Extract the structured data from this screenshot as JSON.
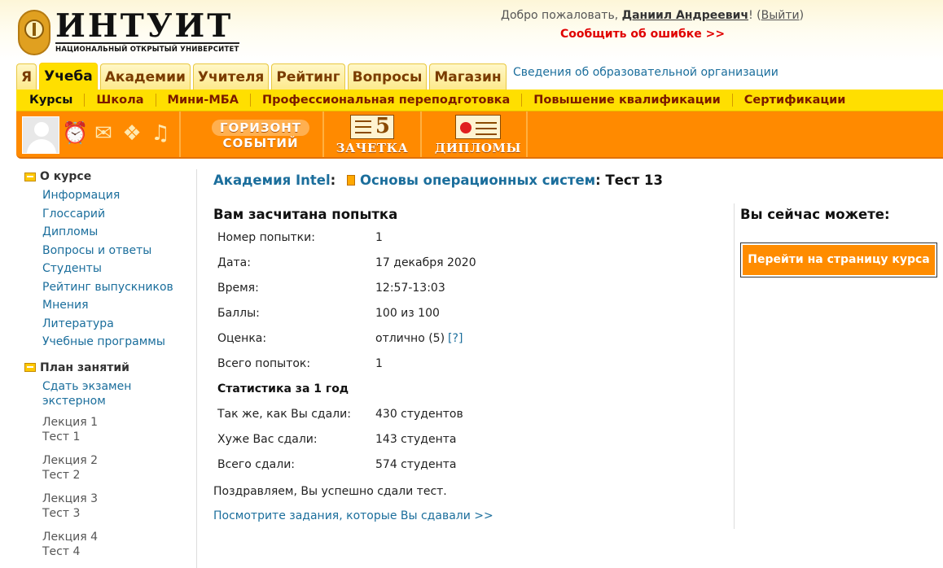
{
  "header": {
    "logo_title": "ИНТУИТ",
    "logo_subtitle": "НАЦИОНАЛЬНЫЙ ОТКРЫТЫЙ УНИВЕРСИТЕТ",
    "welcome_prefix": "Добро пожаловать,",
    "user_name": "Даниил Андреевич",
    "welcome_excl": "!",
    "logout_open": "(",
    "logout_label": "Выйти",
    "logout_close": ")",
    "report_error": "Сообщить об ошибке >>"
  },
  "tabs": [
    {
      "label": "Я",
      "active": false
    },
    {
      "label": "Учеба",
      "active": true
    },
    {
      "label": "Академии",
      "active": false
    },
    {
      "label": "Учителя",
      "active": false
    },
    {
      "label": "Рейтинг",
      "active": false
    },
    {
      "label": "Вопросы",
      "active": false
    },
    {
      "label": "Магазин",
      "active": false
    }
  ],
  "org_info_link": "Сведения об образовательной организации",
  "subnav": [
    {
      "label": "Курсы",
      "active": true
    },
    {
      "label": "Школа",
      "active": false
    },
    {
      "label": "Мини-МБА",
      "active": false
    },
    {
      "label": "Профессиональная переподготовка",
      "active": false
    },
    {
      "label": "Повышение квалификации",
      "active": false
    },
    {
      "label": "Сертификации",
      "active": false
    }
  ],
  "toolbar": {
    "horizon_line1": "ГОРИЗОНТ",
    "horizon_line2": "СОБЫТИЙ",
    "zachetka_label": "ЗАЧЕТКА",
    "zachetka_number": "5",
    "diplomy_label": "ДИПЛОМЫ",
    "icons": [
      "alarm-clock-icon",
      "envelope-icon",
      "gifts-icon",
      "bell-icon"
    ]
  },
  "sidebar": {
    "about_title": "О курсе",
    "about_links": [
      "Информация",
      "Глоссарий",
      "Дипломы",
      "Вопросы и ответы",
      "Студенты",
      "Рейтинг выпускников",
      "Мнения",
      "Литература",
      "Учебные программы"
    ],
    "plan_title": "План занятий",
    "external_exam": "Сдать экзамен экстерном",
    "lectures": [
      {
        "lecture": "Лекция 1",
        "test": "Тест 1"
      },
      {
        "lecture": "Лекция 2",
        "test": "Тест 2"
      },
      {
        "lecture": "Лекция 3",
        "test": "Тест 3"
      },
      {
        "lecture": "Лекция 4",
        "test": "Тест 4"
      }
    ]
  },
  "breadcrumb": {
    "academy": "Академия Intel",
    "sep1": ":",
    "course": "Основы операционных систем",
    "sep2": ":",
    "current": "Тест 13"
  },
  "result": {
    "title": "Вам засчитана попытка",
    "attempt_label": "Номер попытки:",
    "attempt_value": "1",
    "date_label": "Дата:",
    "date_value": "17 декабря 2020",
    "time_label": "Время:",
    "time_value": "12:57-13:03",
    "score_label": "Баллы:",
    "score_value": "100 из 100",
    "grade_label": "Оценка:",
    "grade_value": "отлично (5)",
    "grade_help": "[?]",
    "total_attempts_label": "Всего попыток:",
    "total_attempts_value": "1",
    "stats_title": "Статистика за 1 год",
    "same_label": "Так же, как Вы сдали:",
    "same_value": "430 студентов",
    "worse_label": "Хуже Вас сдали:",
    "worse_value": "143 студента",
    "total_label": "Всего сдали:",
    "total_value": "574 студента",
    "congrats": "Поздравляем, Вы успешно сдали тест.",
    "view_tasks": "Посмотрите задания, которые Вы сдавали >>"
  },
  "actions": {
    "title": "Вы сейчас можете:",
    "go_course": "Перейти на страницу курса"
  },
  "colors": {
    "tab_active": "#ffdf00",
    "toolbar": "#ff8a00",
    "link": "#1b6e9c",
    "error": "#e00000"
  }
}
